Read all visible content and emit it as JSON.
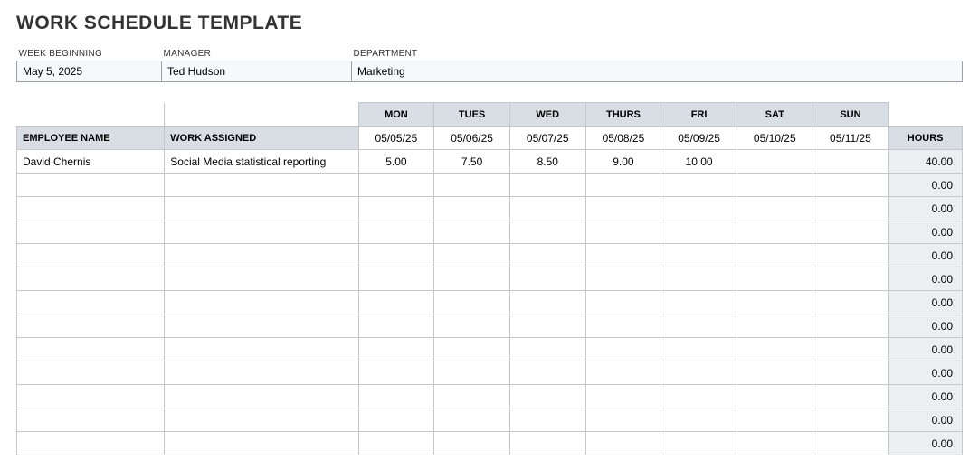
{
  "title": "WORK SCHEDULE TEMPLATE",
  "info": {
    "labels": {
      "week": "WEEK BEGINNING",
      "manager": "MANAGER",
      "department": "DEPARTMENT"
    },
    "values": {
      "week": "May 5, 2025",
      "manager": "Ted Hudson",
      "department": "Marketing"
    }
  },
  "headers": {
    "employee": "EMPLOYEE NAME",
    "work": "WORK ASSIGNED",
    "hours": "HOURS",
    "days": [
      "MON",
      "TUES",
      "WED",
      "THURS",
      "FRI",
      "SAT",
      "SUN"
    ],
    "dates": [
      "05/05/25",
      "05/06/25",
      "05/07/25",
      "05/08/25",
      "05/09/25",
      "05/10/25",
      "05/11/25"
    ]
  },
  "rows": [
    {
      "name": "David Chernis",
      "work": "Social Media statistical reporting",
      "d": [
        "5.00",
        "7.50",
        "8.50",
        "9.00",
        "10.00",
        "",
        ""
      ],
      "hours": "40.00"
    },
    {
      "name": "",
      "work": "",
      "d": [
        "",
        "",
        "",
        "",
        "",
        "",
        ""
      ],
      "hours": "0.00"
    },
    {
      "name": "",
      "work": "",
      "d": [
        "",
        "",
        "",
        "",
        "",
        "",
        ""
      ],
      "hours": "0.00"
    },
    {
      "name": "",
      "work": "",
      "d": [
        "",
        "",
        "",
        "",
        "",
        "",
        ""
      ],
      "hours": "0.00"
    },
    {
      "name": "",
      "work": "",
      "d": [
        "",
        "",
        "",
        "",
        "",
        "",
        ""
      ],
      "hours": "0.00"
    },
    {
      "name": "",
      "work": "",
      "d": [
        "",
        "",
        "",
        "",
        "",
        "",
        ""
      ],
      "hours": "0.00"
    },
    {
      "name": "",
      "work": "",
      "d": [
        "",
        "",
        "",
        "",
        "",
        "",
        ""
      ],
      "hours": "0.00"
    },
    {
      "name": "",
      "work": "",
      "d": [
        "",
        "",
        "",
        "",
        "",
        "",
        ""
      ],
      "hours": "0.00"
    },
    {
      "name": "",
      "work": "",
      "d": [
        "",
        "",
        "",
        "",
        "",
        "",
        ""
      ],
      "hours": "0.00"
    },
    {
      "name": "",
      "work": "",
      "d": [
        "",
        "",
        "",
        "",
        "",
        "",
        ""
      ],
      "hours": "0.00"
    },
    {
      "name": "",
      "work": "",
      "d": [
        "",
        "",
        "",
        "",
        "",
        "",
        ""
      ],
      "hours": "0.00"
    },
    {
      "name": "",
      "work": "",
      "d": [
        "",
        "",
        "",
        "",
        "",
        "",
        ""
      ],
      "hours": "0.00"
    },
    {
      "name": "",
      "work": "",
      "d": [
        "",
        "",
        "",
        "",
        "",
        "",
        ""
      ],
      "hours": "0.00"
    }
  ]
}
